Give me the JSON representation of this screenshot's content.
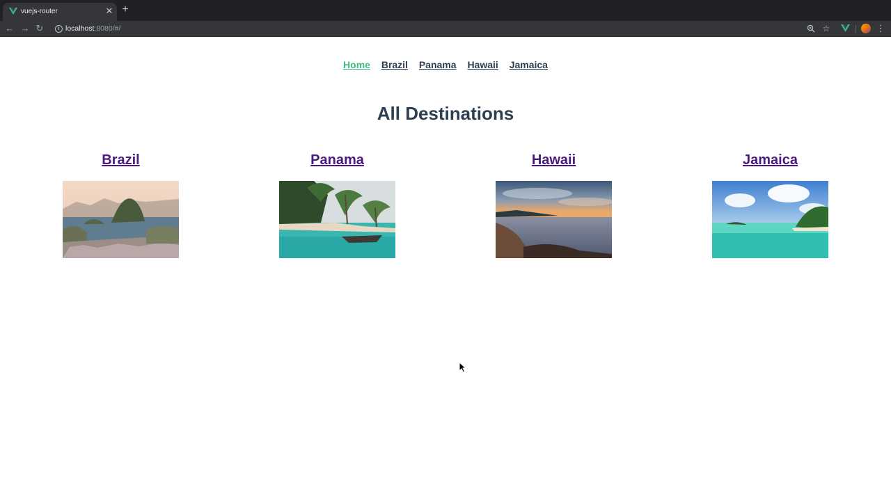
{
  "browser": {
    "tab": {
      "title": "vuejs-router",
      "favicon": "vue-logo-icon",
      "close_icon": "close-icon"
    },
    "new_tab_icon": "plus-icon",
    "toolbar": {
      "back_icon": "arrow-left-icon",
      "forward_icon": "arrow-right-icon",
      "reload_icon": "reload-icon",
      "url_host": "localhost",
      "url_rest": ":8080/#/",
      "zoom_icon": "zoom-icon",
      "bookmark_icon": "star-icon",
      "extension_icon": "vue-devtools-icon",
      "menu_icon": "kebab-menu-icon"
    }
  },
  "nav": {
    "links": [
      {
        "label": "Home",
        "active": true
      },
      {
        "label": "Brazil",
        "active": false
      },
      {
        "label": "Panama",
        "active": false
      },
      {
        "label": "Hawaii",
        "active": false
      },
      {
        "label": "Jamaica",
        "active": false
      }
    ]
  },
  "main": {
    "title": "All Destinations",
    "destinations": [
      {
        "name": "Brazil"
      },
      {
        "name": "Panama"
      },
      {
        "name": "Hawaii"
      },
      {
        "name": "Jamaica"
      }
    ]
  },
  "colors": {
    "active_link": "#42b983",
    "text": "#2c3e50",
    "destination_link": "#4b1a7f",
    "chrome_dark": "#202124",
    "chrome_toolbar": "#35363a"
  }
}
